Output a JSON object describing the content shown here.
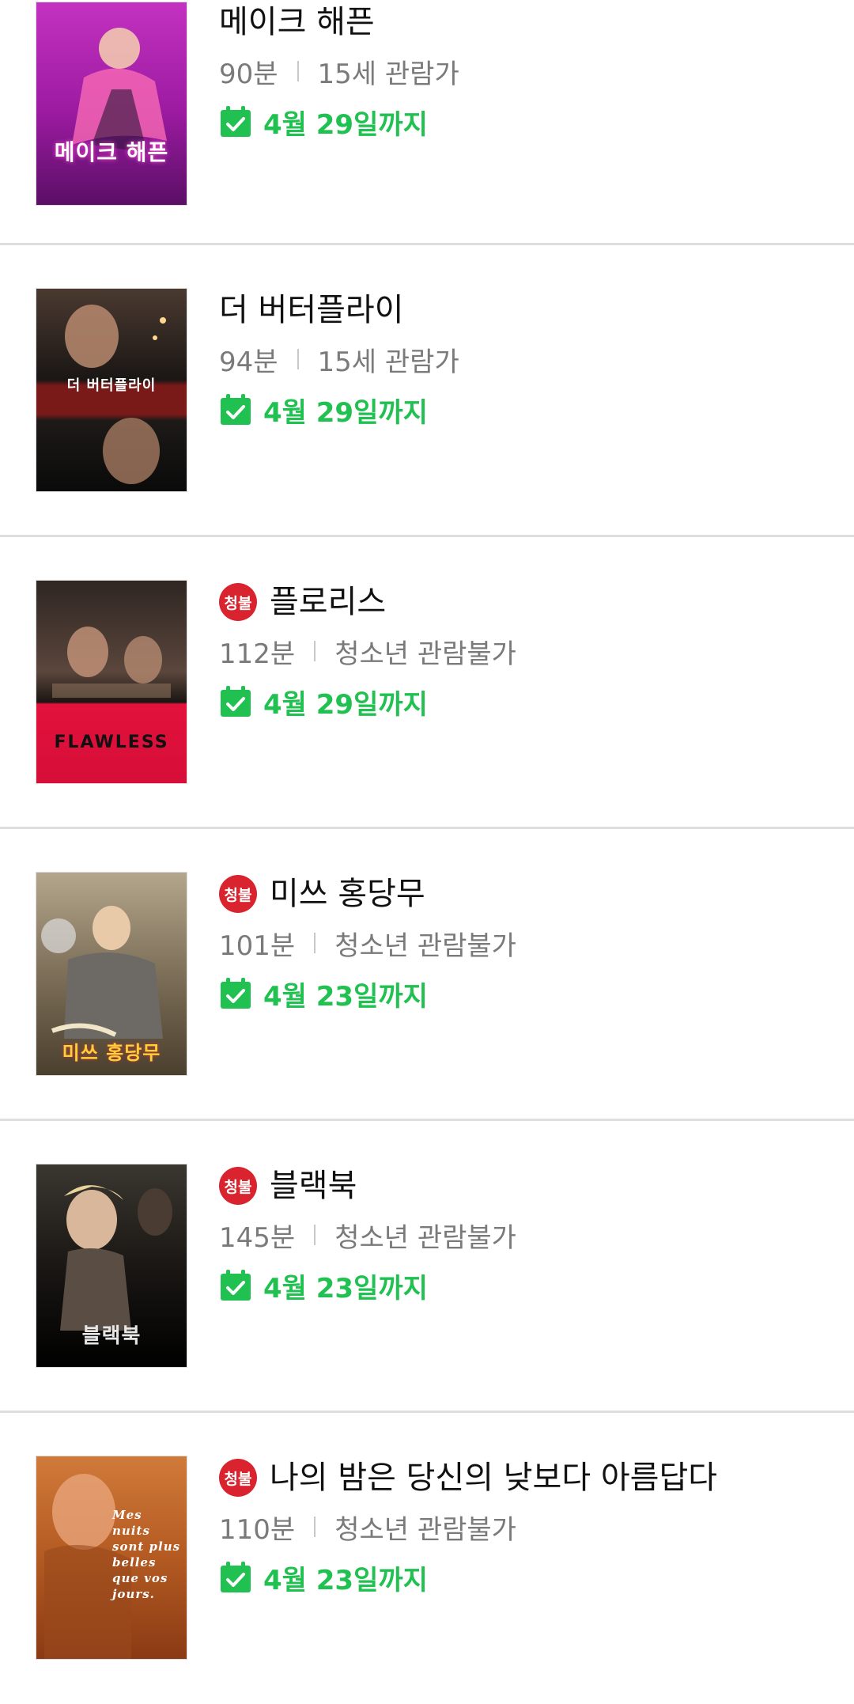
{
  "movies": [
    {
      "title": "메이크 해픈",
      "rating_badge": "",
      "runtime": "90분",
      "age_rating": "15세 관람가",
      "available_until": "4월 29일까지",
      "poster_text": "메이크 해픈",
      "poster_colors": [
        "#d12fc4",
        "#6a1470"
      ]
    },
    {
      "title": "더 버터플라이",
      "rating_badge": "",
      "runtime": "94분",
      "age_rating": "15세 관람가",
      "available_until": "4월 29일까지",
      "poster_text": "더 버터플라이",
      "poster_colors": [
        "#3a2a24",
        "#0b0b0b"
      ]
    },
    {
      "title": "플로리스",
      "rating_badge": "청불",
      "runtime": "112분",
      "age_rating": "청소년 관람불가",
      "available_until": "4월 29일까지",
      "poster_text": "FLAWLESS",
      "poster_colors": [
        "#3b2f2a",
        "#e2123c"
      ]
    },
    {
      "title": "미쓰 홍당무",
      "rating_badge": "청불",
      "runtime": "101분",
      "age_rating": "청소년 관람불가",
      "available_until": "4월 23일까지",
      "poster_text": "미쓰 홍당무",
      "poster_colors": [
        "#8a7a60",
        "#4a4030"
      ]
    },
    {
      "title": "블랙북",
      "rating_badge": "청불",
      "runtime": "145분",
      "age_rating": "청소년 관람불가",
      "available_until": "4월 23일까지",
      "poster_text": "블랙북",
      "poster_colors": [
        "#2a2622",
        "#000000"
      ]
    },
    {
      "title": "나의 밤은 당신의 낮보다 아름답다",
      "rating_badge": "청불",
      "runtime": "110분",
      "age_rating": "청소년 관람불가",
      "available_until": "4월 23일까지",
      "poster_text": "Mes nuits sont plus belles que vos jours.",
      "poster_colors": [
        "#c46a2a",
        "#7a3412"
      ]
    }
  ],
  "icons": {
    "calendar_check": "calendar-check-icon",
    "accent_green": "#20c151",
    "badge_red": "#d9232e"
  }
}
